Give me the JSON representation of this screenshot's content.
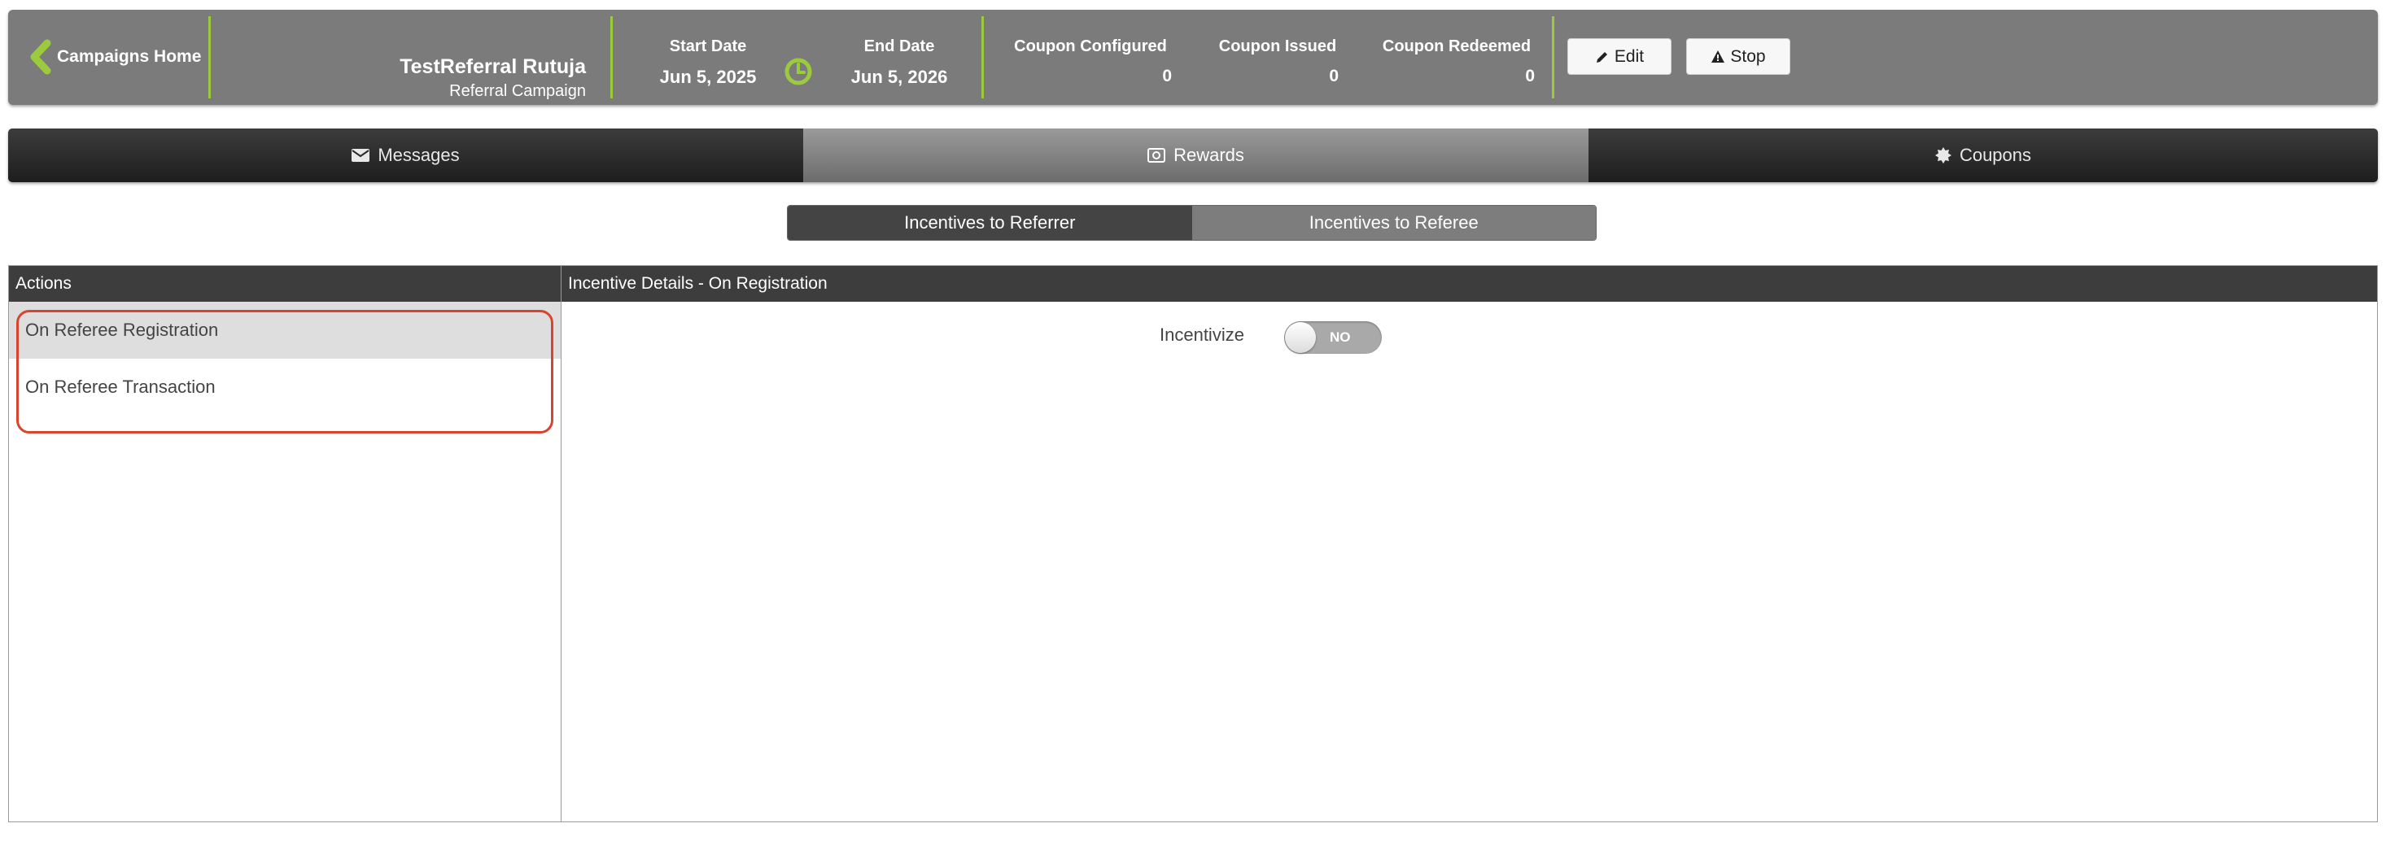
{
  "header": {
    "back_label": "Campaigns Home",
    "campaign_name": "TestReferral Rutuja",
    "campaign_type": "Referral Campaign",
    "start_date_label": "Start Date",
    "start_date": "Jun 5, 2025",
    "end_date_label": "End Date",
    "end_date": "Jun 5, 2026",
    "coupon_configured_label": "Coupon Configured",
    "coupon_configured": "0",
    "coupon_issued_label": "Coupon Issued",
    "coupon_issued": "0",
    "coupon_redeemed_label": "Coupon Redeemed",
    "coupon_redeemed": "0",
    "edit_label": "Edit",
    "stop_label": "Stop",
    "accent_color": "#9bcb3c"
  },
  "tabs": [
    {
      "label": "Messages",
      "icon": "envelope-icon",
      "active": false
    },
    {
      "label": "Rewards",
      "icon": "money-icon",
      "active": true
    },
    {
      "label": "Coupons",
      "icon": "badge-icon",
      "active": false
    }
  ],
  "subtabs": [
    {
      "label": "Incentives to Referrer",
      "active": true
    },
    {
      "label": "Incentives to Referee",
      "active": false
    }
  ],
  "actions_panel": {
    "title": "Actions",
    "items": [
      {
        "label": "On Referee Registration",
        "selected": true
      },
      {
        "label": "On Referee Transaction",
        "selected": false
      }
    ],
    "highlight_color": "#d9442e"
  },
  "details_panel": {
    "title": "Incentive Details - On Registration",
    "incentivize_label": "Incentivize",
    "toggle_label": "NO",
    "toggle_on": false
  }
}
